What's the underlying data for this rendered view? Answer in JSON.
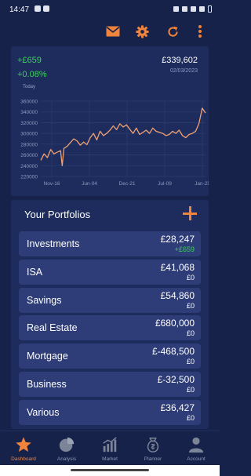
{
  "status_bar": {
    "time": "14:47"
  },
  "toolbar": {
    "icons": [
      "mail-icon",
      "gear-icon",
      "refresh-icon",
      "more-vertical-icon"
    ],
    "accent": "#f0843c"
  },
  "summary": {
    "change_abs": "+£659",
    "change_pct": "+0.08%",
    "period_label": "Today",
    "total_value": "£339,602",
    "date": "02/03/2023"
  },
  "chart_data": {
    "type": "line",
    "title": "",
    "xlabel": "",
    "ylabel": "",
    "x_tick_labels": [
      "Nov-16",
      "Jun-04",
      "Dec-21",
      "Jul-09",
      "Jan-25"
    ],
    "y_tick_labels": [
      "220000",
      "240000",
      "260000",
      "280000",
      "300000",
      "320000",
      "340000",
      "360000"
    ],
    "ylim": [
      220000,
      360000
    ],
    "grid": true,
    "line_color": "#f0a070",
    "series": [
      {
        "x": [
          0,
          0.02,
          0.04,
          0.06,
          0.08,
          0.1,
          0.12,
          0.13,
          0.14,
          0.16,
          0.18,
          0.2,
          0.22,
          0.24,
          0.26,
          0.28,
          0.3,
          0.32,
          0.34,
          0.36,
          0.38,
          0.4,
          0.42,
          0.44,
          0.46,
          0.48,
          0.5,
          0.52,
          0.54,
          0.56,
          0.58,
          0.6,
          0.62,
          0.64,
          0.66,
          0.68,
          0.7,
          0.72,
          0.74,
          0.76,
          0.78,
          0.8,
          0.82,
          0.84,
          0.86,
          0.88,
          0.9,
          0.92,
          0.94,
          0.96,
          0.98,
          1.0
        ],
        "values": [
          250000,
          262000,
          255000,
          270000,
          262000,
          265000,
          268000,
          240000,
          272000,
          276000,
          283000,
          290000,
          286000,
          278000,
          284000,
          279000,
          292000,
          300000,
          288000,
          304000,
          296000,
          300000,
          306000,
          314000,
          307000,
          318000,
          312000,
          316000,
          308000,
          300000,
          310000,
          298000,
          302000,
          306000,
          300000,
          310000,
          304000,
          302000,
          300000,
          296000,
          298000,
          304000,
          300000,
          306000,
          296000,
          292000,
          298000,
          300000,
          304000,
          318000,
          347000,
          338000
        ]
      }
    ]
  },
  "portfolios": {
    "title": "Your Portfolios",
    "items": [
      {
        "name": "Investments",
        "value": "£28,247",
        "change": "+£659",
        "positive": true
      },
      {
        "name": "ISA",
        "value": "£41,068",
        "change": "£0",
        "positive": false
      },
      {
        "name": "Savings",
        "value": "£54,860",
        "change": "£0",
        "positive": false
      },
      {
        "name": "Real Estate",
        "value": "£680,000",
        "change": "£0",
        "positive": false
      },
      {
        "name": "Mortgage",
        "value": "£-468,500",
        "change": "£0",
        "positive": false
      },
      {
        "name": "Business",
        "value": "£-32,500",
        "change": "£0",
        "positive": false
      },
      {
        "name": "Various",
        "value": "£36,427",
        "change": "£0",
        "positive": false
      }
    ]
  },
  "nav": {
    "items": [
      {
        "label": "Dashboard",
        "icon": "star-icon",
        "active": true
      },
      {
        "label": "Analysis",
        "icon": "pie-chart-icon",
        "active": false
      },
      {
        "label": "Market",
        "icon": "bar-chart-icon",
        "active": false
      },
      {
        "label": "Planner",
        "icon": "money-bag-icon",
        "active": false
      },
      {
        "label": "Account",
        "icon": "user-icon",
        "active": false
      }
    ]
  }
}
